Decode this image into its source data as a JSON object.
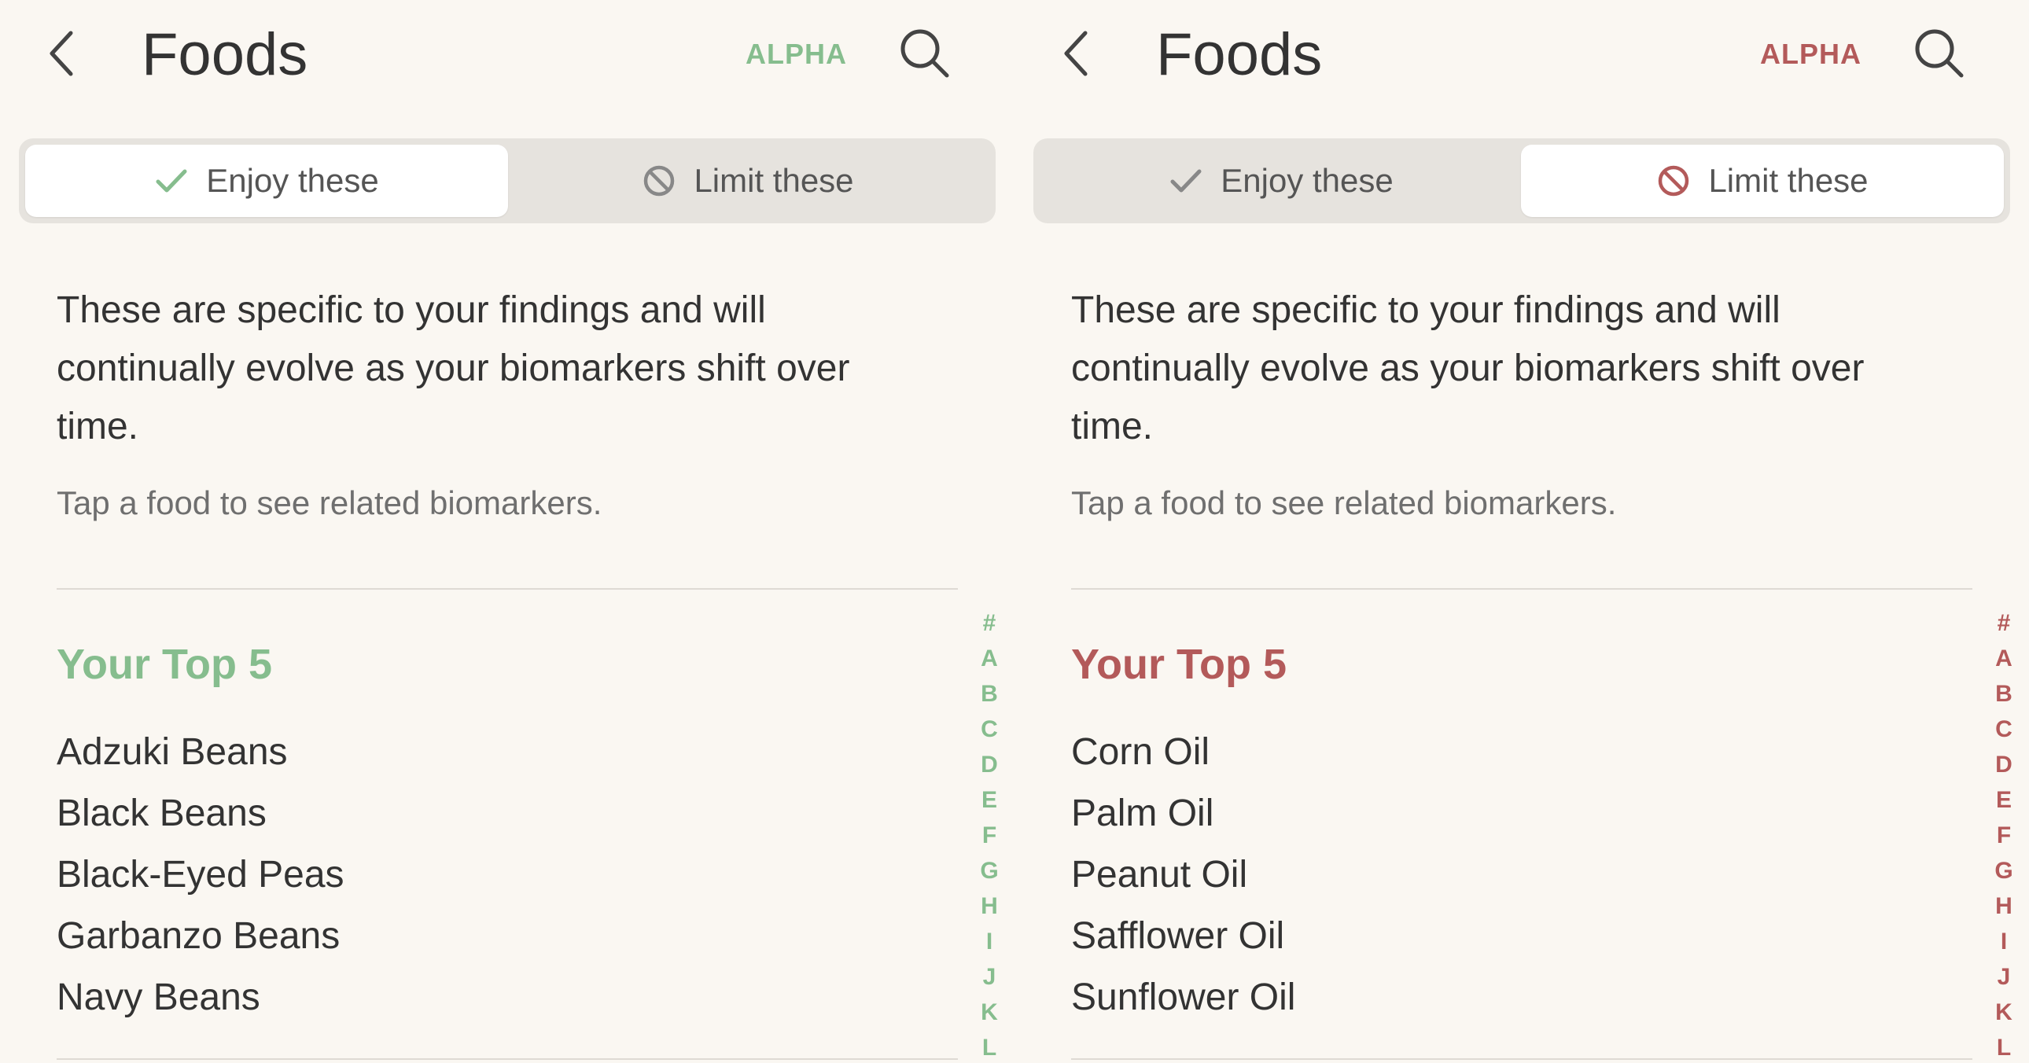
{
  "colors": {
    "enjoy_accent": "#86bd8e",
    "limit_accent": "#b35a5a",
    "text_primary": "#333333",
    "text_secondary": "#6f6f6f",
    "background": "#faf7f2",
    "segment_background": "#e6e3de"
  },
  "panels": [
    {
      "header": {
        "title": "Foods",
        "badge": "ALPHA",
        "back_icon": "chevron-left-icon",
        "search_icon": "search-icon"
      },
      "segmented": {
        "active": "enjoy",
        "enjoy_label": "Enjoy these",
        "enjoy_icon": "checkmark-icon",
        "limit_label": "Limit these",
        "limit_icon": "prohibited-icon"
      },
      "description": "These are specific to your findings and will continually evolve as your biomarkers shift over time.",
      "hint": "Tap a food to see related biomarkers.",
      "section_title": "Your Top 5",
      "foods": [
        "Adzuki Beans",
        "Black Beans",
        "Black-Eyed Peas",
        "Garbanzo Beans",
        "Navy Beans"
      ],
      "index_letters": [
        "#",
        "A",
        "B",
        "C",
        "D",
        "E",
        "F",
        "G",
        "H",
        "I",
        "J",
        "K",
        "L"
      ],
      "accent": "#86bd8e"
    },
    {
      "header": {
        "title": "Foods",
        "badge": "ALPHA",
        "back_icon": "chevron-left-icon",
        "search_icon": "search-icon"
      },
      "segmented": {
        "active": "limit",
        "enjoy_label": "Enjoy these",
        "enjoy_icon": "checkmark-icon",
        "limit_label": "Limit these",
        "limit_icon": "prohibited-icon"
      },
      "description": "These are specific to your findings and will continually evolve as your biomarkers shift over time.",
      "hint": "Tap a food to see related biomarkers.",
      "section_title": "Your Top 5",
      "foods": [
        "Corn Oil",
        "Palm Oil",
        "Peanut Oil",
        "Safflower Oil",
        "Sunflower Oil"
      ],
      "index_letters": [
        "#",
        "A",
        "B",
        "C",
        "D",
        "E",
        "F",
        "G",
        "H",
        "I",
        "J",
        "K",
        "L"
      ],
      "accent": "#b35a5a"
    }
  ]
}
